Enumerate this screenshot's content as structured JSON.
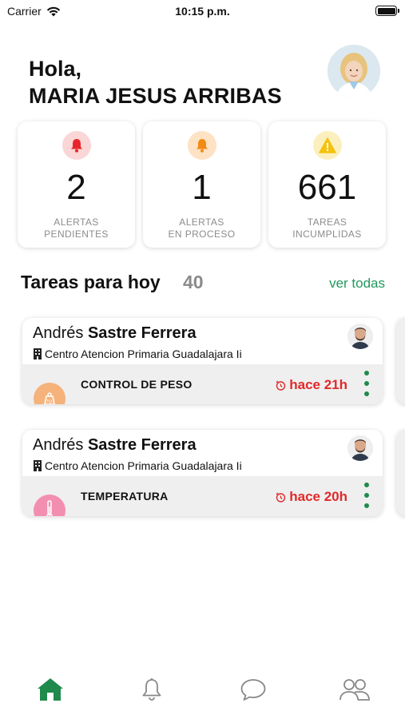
{
  "status_bar": {
    "carrier": "Carrier",
    "time": "10:15 p.m."
  },
  "greeting": {
    "hello": "Hola,",
    "name": "MARIA JESUS ARRIBAS"
  },
  "stats": [
    {
      "value": "2",
      "label": "ALERTAS\nPENDIENTES",
      "icon": "bell-icon",
      "icon_color": "#e8252b",
      "icon_bg": "#fbd6d6"
    },
    {
      "value": "1",
      "label": "ALERTAS\nEN PROCESO",
      "icon": "bell-icon",
      "icon_color": "#f28a13",
      "icon_bg": "#fde2c4"
    },
    {
      "value": "661",
      "label": "TAREAS\nINCUMPLIDAS",
      "icon": "warning-icon",
      "icon_color": "#f4c20f",
      "icon_bg": "#fcefbe"
    }
  ],
  "tasks_section": {
    "title": "Tareas para hoy",
    "count": "40",
    "see_all": "ver todas"
  },
  "tasks": [
    {
      "first_name": "Andrés",
      "last_name": "Sastre Ferrera",
      "center": "Centro Atencion Primaria Guadalajara Ii",
      "type": "CONTROL DE PESO",
      "time": "hace 21h",
      "badge_icon": "weight-icon",
      "badge_color": "#f5b27a"
    },
    {
      "first_name": "Andrés",
      "last_name": "Sastre Ferrera",
      "center": "Centro Atencion Primaria Guadalajara Ii",
      "type": "TEMPERATURA",
      "time": "hace 20h",
      "badge_icon": "thermometer-icon",
      "badge_color": "#f28fb0"
    }
  ],
  "tab_bar": [
    {
      "name": "home-icon",
      "active": true
    },
    {
      "name": "bell-icon",
      "active": false
    },
    {
      "name": "chat-icon",
      "active": false
    },
    {
      "name": "users-icon",
      "active": false
    }
  ],
  "colors": {
    "accent": "#1f9a5b",
    "alert": "#e02a2a",
    "muted_text": "#8c8c8c"
  }
}
